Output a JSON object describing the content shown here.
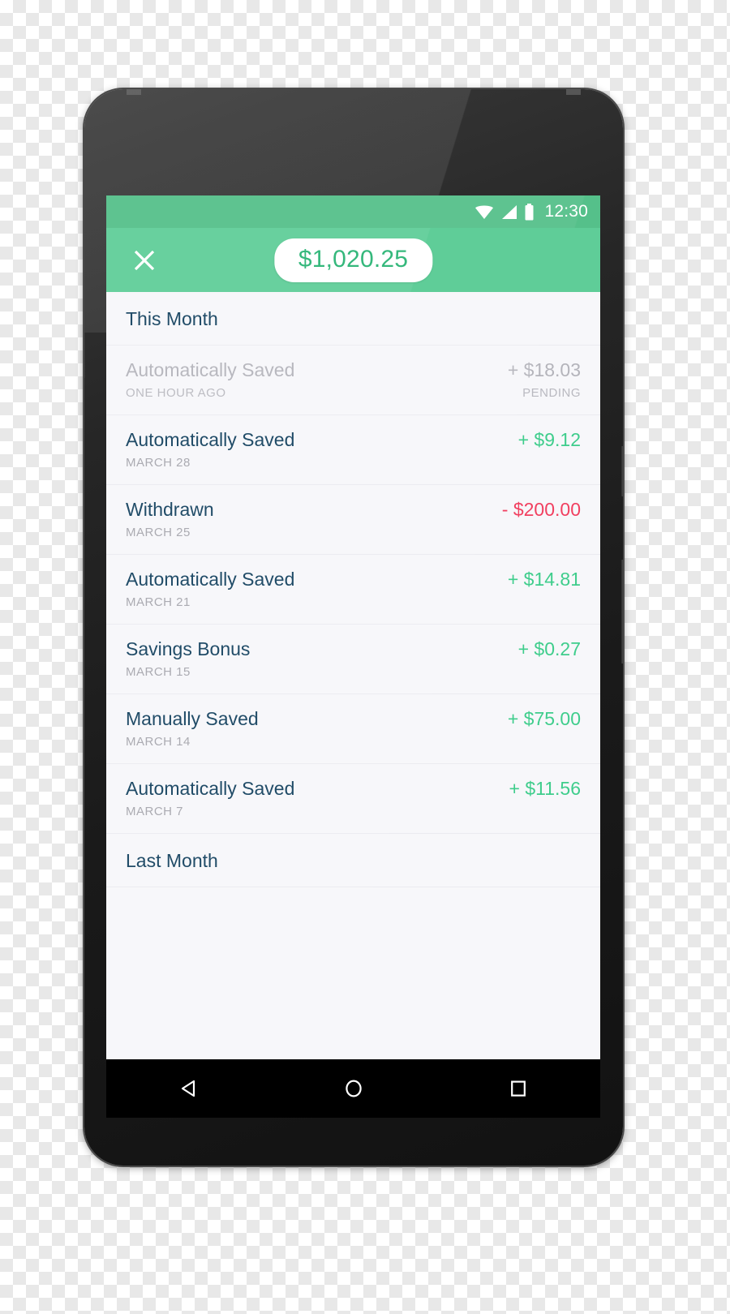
{
  "device": {
    "name": "android-smartphone",
    "front_camera": "front-camera",
    "earpiece": "earpiece-speaker",
    "bottom_speaker": "bottom-speaker"
  },
  "status_bar": {
    "time": "12:30",
    "icons": [
      "wifi-icon",
      "cellular-signal-icon",
      "battery-icon"
    ],
    "background": "#55c08a"
  },
  "toolbar": {
    "close_label": "close-icon",
    "balance": "$1,020.25",
    "background": "#5fcd98",
    "balance_text_color": "#35b87c"
  },
  "colors": {
    "accent_green": "#5fcd98",
    "amount_positive": "#3fcd8c",
    "amount_negative": "#f14060",
    "title_navy": "#14425f",
    "muted_grey": "#a6a6ad",
    "list_background": "#f7f7fa"
  },
  "sections": [
    {
      "label": "This Month",
      "rows": [
        {
          "title": "Automatically Saved",
          "date": "ONE HOUR AGO",
          "amount": "+ $18.03",
          "status": "PENDING",
          "sign": "positive",
          "pending": true
        },
        {
          "title": "Automatically Saved",
          "date": "MARCH 28",
          "amount": "+ $9.12",
          "status": "",
          "sign": "positive",
          "pending": false
        },
        {
          "title": "Withdrawn",
          "date": "MARCH 25",
          "amount": "- $200.00",
          "status": "",
          "sign": "negative",
          "pending": false
        },
        {
          "title": "Automatically Saved",
          "date": "MARCH 21",
          "amount": "+ $14.81",
          "status": "",
          "sign": "positive",
          "pending": false
        },
        {
          "title": "Savings Bonus",
          "date": "MARCH 15",
          "amount": "+ $0.27",
          "status": "",
          "sign": "positive",
          "pending": false
        },
        {
          "title": "Manually Saved",
          "date": "MARCH 14",
          "amount": "+ $75.00",
          "status": "",
          "sign": "positive",
          "pending": false
        },
        {
          "title": "Automatically Saved",
          "date": "MARCH 7",
          "amount": "+ $11.56",
          "status": "",
          "sign": "positive",
          "pending": false
        }
      ]
    },
    {
      "label": "Last Month",
      "rows": []
    }
  ],
  "nav_bar": {
    "buttons": [
      "back-button",
      "home-button",
      "recents-button"
    ]
  }
}
